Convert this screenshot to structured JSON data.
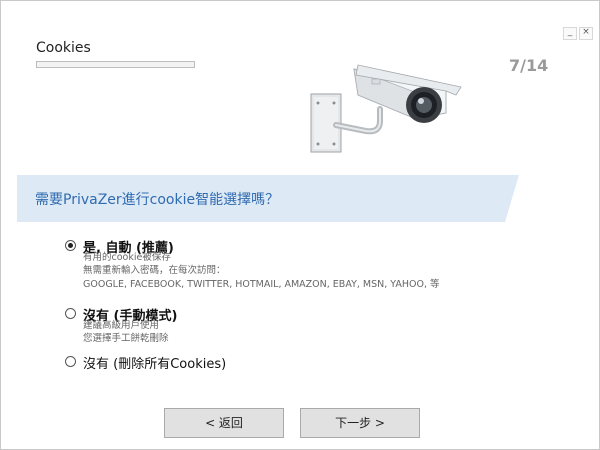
{
  "window": {
    "title": "Cookies",
    "step": "7/14",
    "controls": {
      "minimize": "_",
      "close": "×"
    },
    "progress_fraction": 0.0
  },
  "banner": {
    "question": "需要PrivaZer進行cookie智能選擇嗎？"
  },
  "options": [
    {
      "label": "是, 自動 (推薦)",
      "selected": true,
      "desc": [
        "有用的cookie被保存",
        "無需重新輸入密碼，在每次訪問：",
        "GOOGLE, FACEBOOK, TWITTER, HOTMAIL, AMAZON, EBAY, MSN, YAHOO, 等"
      ]
    },
    {
      "label": "沒有 (手動模式)",
      "selected": false,
      "desc": [
        "建議高級用戶使用",
        "您選擇手工餅乾刪除"
      ]
    },
    {
      "label": "沒有 (刪除所有Cookies)",
      "selected": false,
      "desc": []
    }
  ],
  "buttons": {
    "back": "< 返回",
    "next": "下一步 >"
  },
  "colors": {
    "banner_bg": "#dde9f5",
    "banner_text": "#2f6bb0",
    "step_text": "#9a9a9a",
    "button_bg": "#e1e1e1"
  },
  "icons": {
    "camera": "security-camera-icon"
  }
}
